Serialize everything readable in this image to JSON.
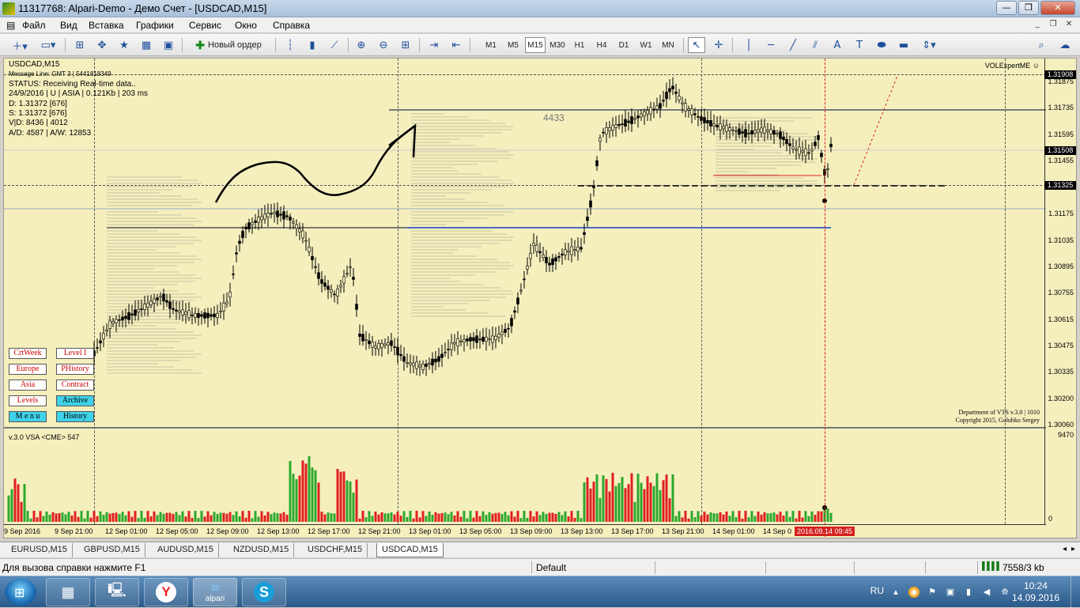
{
  "window": {
    "title": "11317768: Alpari-Demo - Демо Счет - [USDCAD,M15]",
    "minimize": "—",
    "restore": "❐",
    "close": "✕"
  },
  "menu": {
    "items": [
      "Файл",
      "Вид",
      "Вставка",
      "Графики",
      "Сервис",
      "Окно",
      "Справка"
    ]
  },
  "toolbar": {
    "new_order_label": "Новый ордер",
    "timeframes": [
      "M1",
      "M5",
      "M15",
      "M30",
      "H1",
      "H4",
      "D1",
      "W1",
      "MN"
    ],
    "active_timeframe": "M15"
  },
  "chart": {
    "symbol_header": "USDCAD,M15",
    "info_lines": [
      "Message Line: GMT 3 | 5441818349",
      "STATUS:  Receiving Real-time data..",
      "24/9/2016 | U | ASIA | 0.121Kb | 203 ms",
      "D: 1.31372  [676]",
      "S: 1.31372  [676]",
      "V|D: 8436 | 4012",
      "A/D: 4587 | A/W: 12853"
    ],
    "expert_label": "VOLExpertME ☺",
    "volume_level_label": "4433",
    "volume_panel_label": "v.3.0 VSA <CME> 547",
    "department_line1": "Department of VTS  v.3.0 | 1010",
    "department_line2": "Copyright 2015, Golubko Sergey",
    "price_ticks": [
      "1.31875",
      "1.31735",
      "1.31595",
      "1.31455",
      "1.31175",
      "1.31035",
      "1.30895",
      "1.30755",
      "1.30615",
      "1.30475",
      "1.30335",
      "1.30200",
      "1.30060"
    ],
    "price_boxes": [
      "1.31908",
      "1.31508",
      "1.31325"
    ],
    "volume_scale_top": "9470",
    "volume_scale_bottom": "0",
    "time_labels": [
      "9 Sep 2016",
      "9 Sep 21:00",
      "12 Sep 01:00",
      "12 Sep 05:00",
      "12 Sep 09:00",
      "12 Sep 13:00",
      "12 Sep 17:00",
      "12 Sep 21:00",
      "13 Sep 01:00",
      "13 Sep 05:00",
      "13 Sep 09:00",
      "13 Sep 13:00",
      "13 Sep 17:00",
      "13 Sep 21:00",
      "14 Sep 01:00",
      "14 Sep 0"
    ],
    "current_time_label": "2016.09.14 09:45",
    "panel_buttons": [
      {
        "label": "CrtWeek",
        "style": "white"
      },
      {
        "label": "Level I",
        "style": "white"
      },
      {
        "label": "Europe",
        "style": "white"
      },
      {
        "label": "PHistory",
        "style": "white"
      },
      {
        "label": "Asia",
        "style": "white"
      },
      {
        "label": "Contract",
        "style": "white"
      },
      {
        "label": "Levels",
        "style": "white"
      },
      {
        "label": "Archive",
        "style": "cyan"
      },
      {
        "label": "M e n u",
        "style": "cyan"
      },
      {
        "label": "History",
        "style": "cyan"
      }
    ]
  },
  "symbol_tabs": [
    "EURUSD,M15",
    "GBPUSD,M15",
    "AUDUSD,M15",
    "NZDUSD,M15",
    "USDCHF,M15",
    "USDCAD,M15"
  ],
  "active_tab": "USDCAD,M15",
  "status": {
    "help_text": "Для вызова справки нажмите F1",
    "profile": "Default",
    "traffic": "7558/3 kb"
  },
  "taskbar": {
    "alpari_label": "alpari",
    "lang": "RU",
    "time": "10:24",
    "date": "14.09.2016"
  },
  "colors": {
    "chart_bg": "#f5efbe",
    "bull_volume": "#2da82d",
    "bear_volume": "#e02020",
    "now_marker": "#d62020"
  }
}
